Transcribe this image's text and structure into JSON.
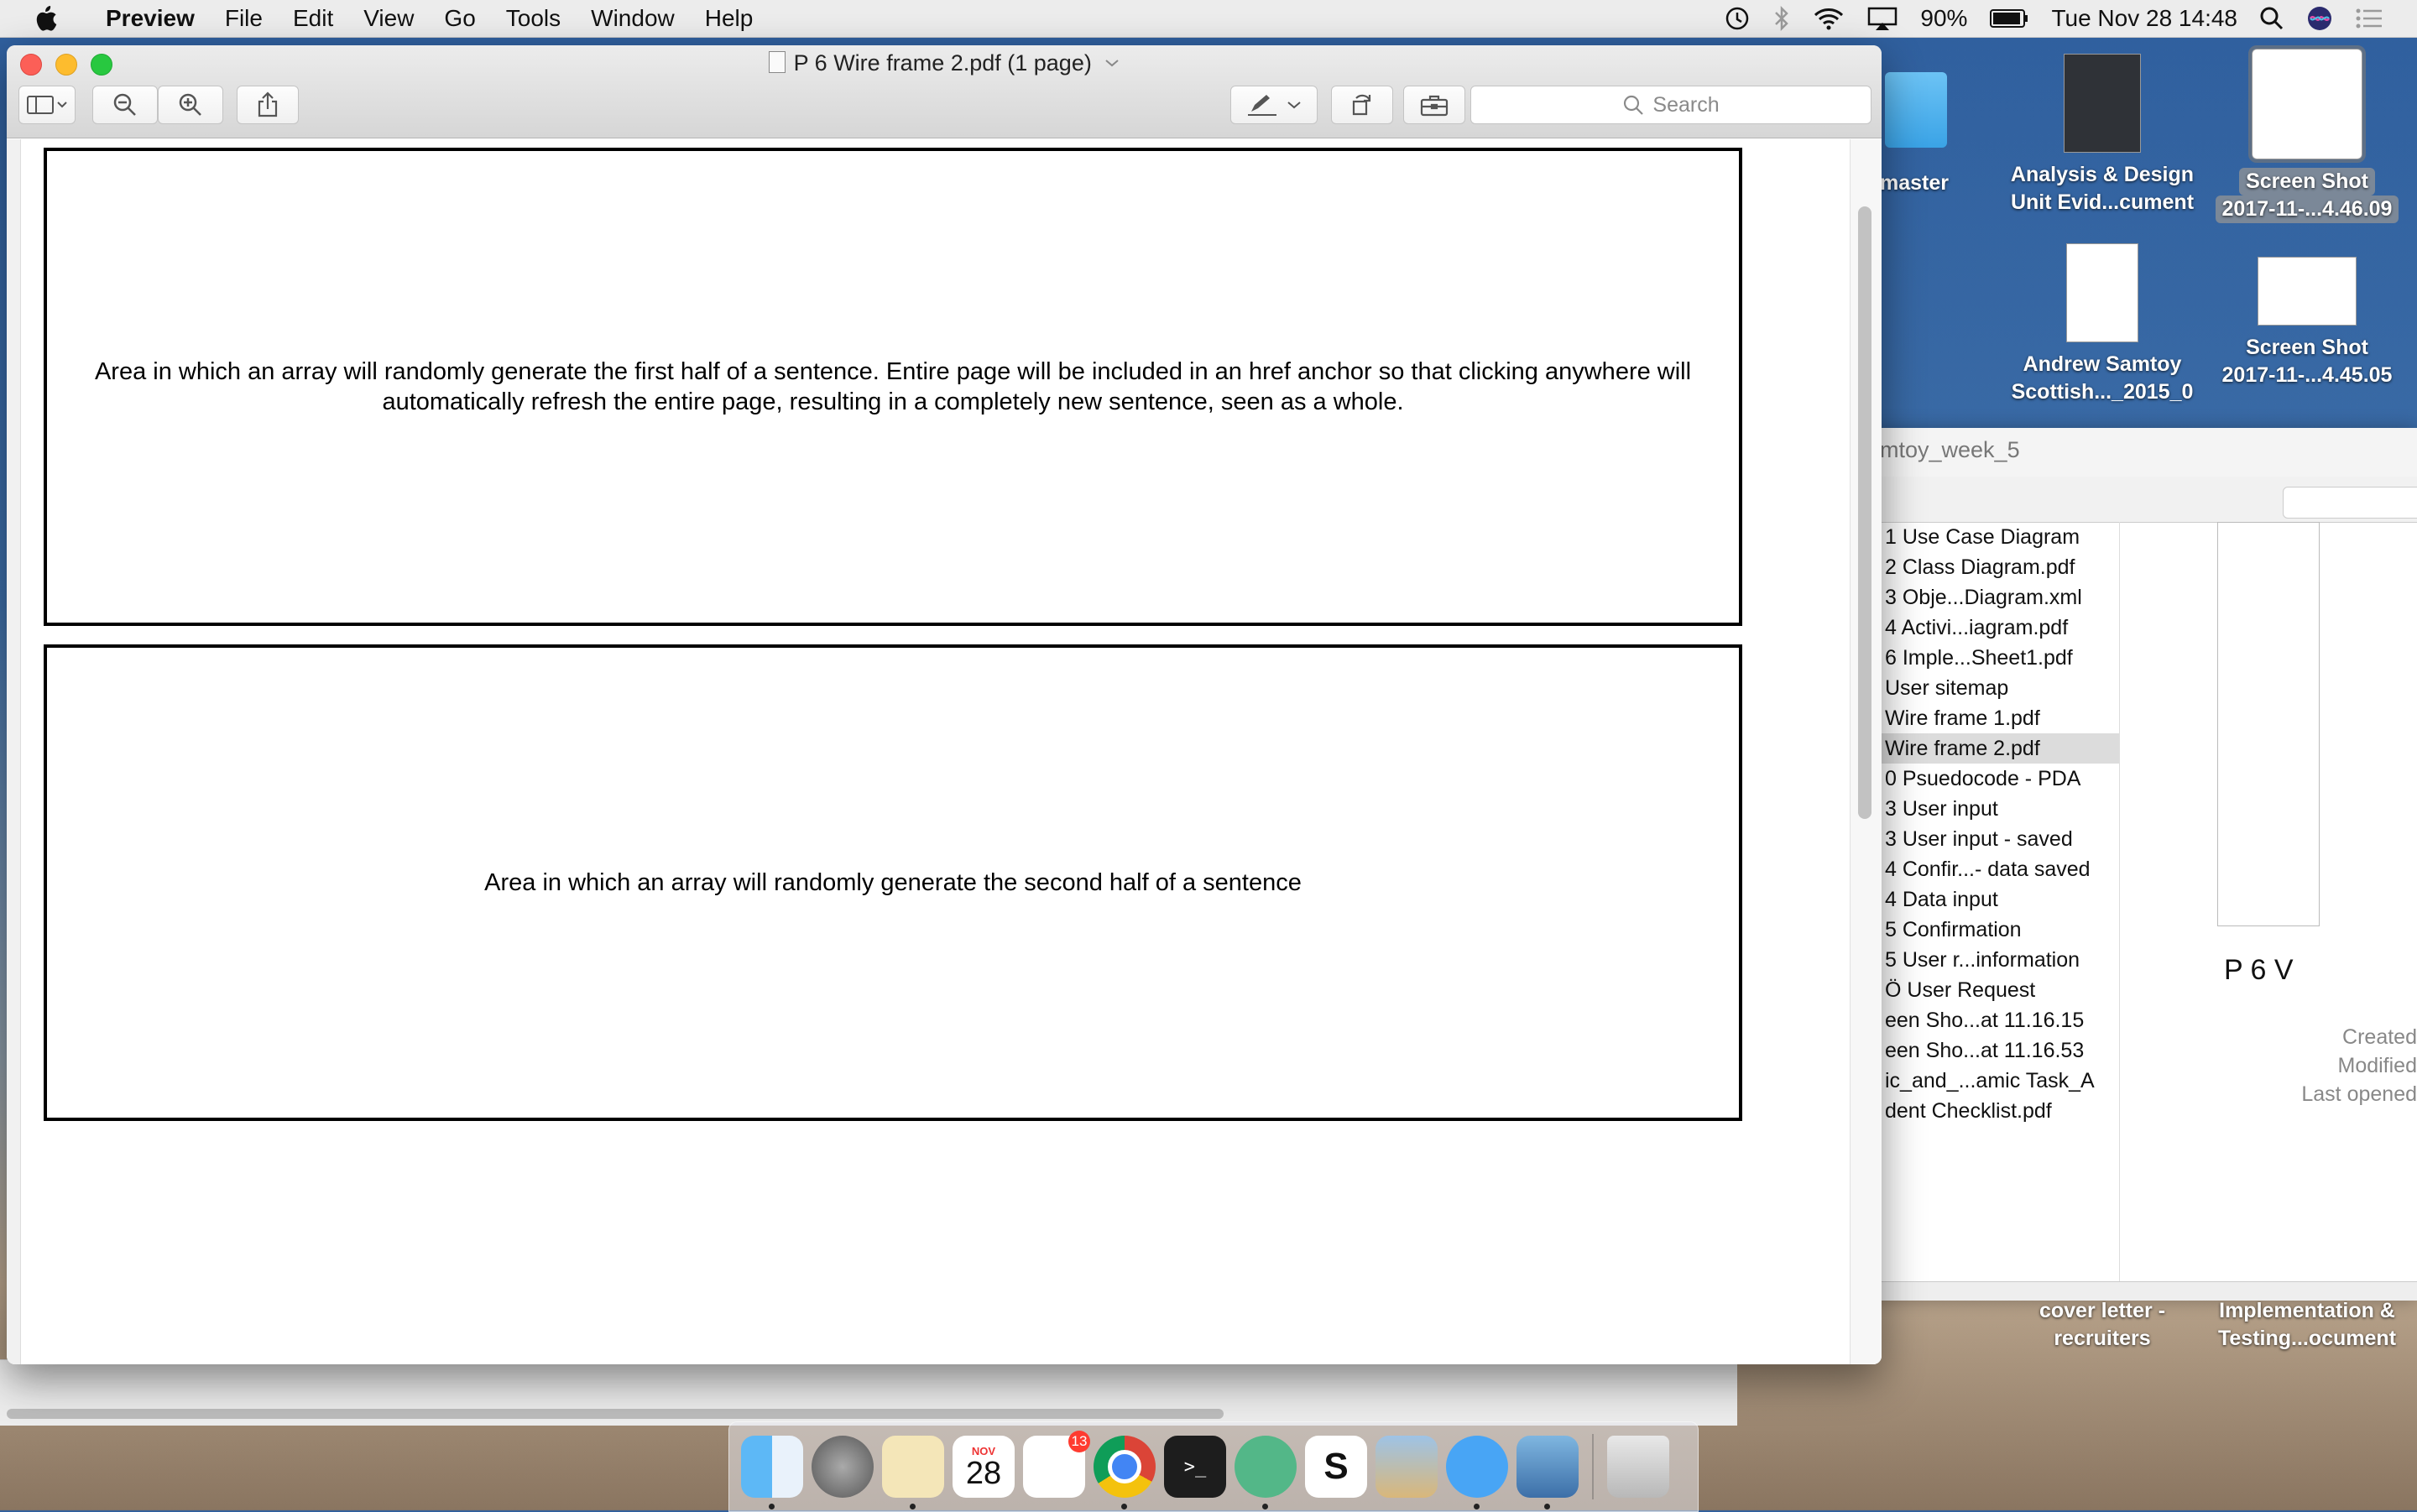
{
  "menubar": {
    "app_name": "Preview",
    "items": [
      "File",
      "Edit",
      "View",
      "Go",
      "Tools",
      "Window",
      "Help"
    ],
    "battery": "90%",
    "clock": "Tue Nov 28  14:48"
  },
  "window": {
    "title": "P 6 Wire frame 2.pdf (1 page)",
    "search_placeholder": "Search"
  },
  "document": {
    "box1_text": "Area in which an array will randomly generate the first half of a sentence.  Entire page will be included in an href anchor so that clicking anywhere will automatically refresh the entire page, resulting in a completely new sentence, seen as a whole.",
    "box2_text": "Area in which an array will randomly generate the second half of a sentence"
  },
  "desktop": {
    "master_label": "master",
    "item1": {
      "line1": "Analysis & Design",
      "line2": "Unit Evid...cument"
    },
    "item2": {
      "line1": "Screen Shot",
      "line2": "2017-11-...4.46.09"
    },
    "item3": {
      "line1": "Andrew Samtoy",
      "line2": "Scottish..._2015_0"
    },
    "item4": {
      "line1": "Screen Shot",
      "line2": "2017-11-...4.45.05"
    },
    "item5": {
      "line1": "cover letter -",
      "line2": "recruiters"
    },
    "item6": {
      "line1": "Implementation &",
      "line2": "Testing...ocument"
    }
  },
  "finder": {
    "title": "mtoy_week_5",
    "rows": [
      "1 Use Case Diagram",
      "2 Class Diagram.pdf",
      "3 Obje...Diagram.xml",
      "4 Activi...iagram.pdf",
      "6 Imple...Sheet1.pdf",
      "User sitemap",
      "Wire frame 1.pdf",
      "Wire frame 2.pdf",
      "0 Psuedocode - PDA",
      "3 User input",
      "3 User input - saved",
      "4 Confir...- data saved",
      "4 Data input",
      "5 Confirmation",
      "5 User r...information",
      "Ö User Request",
      "een Sho...at 11.16.15",
      "een Sho...at 11.16.53",
      "ic_and_...amic Task_A",
      "dent Checklist.pdf"
    ],
    "selected_row": "Wire frame 2.pdf",
    "preview_title": "P 6 V",
    "meta_created": "Created",
    "meta_modified": "Modified",
    "meta_last_opened": "Last opened"
  },
  "dock": {
    "calendar_month": "NOV",
    "calendar_day": "28",
    "reminders_badge": "13"
  }
}
